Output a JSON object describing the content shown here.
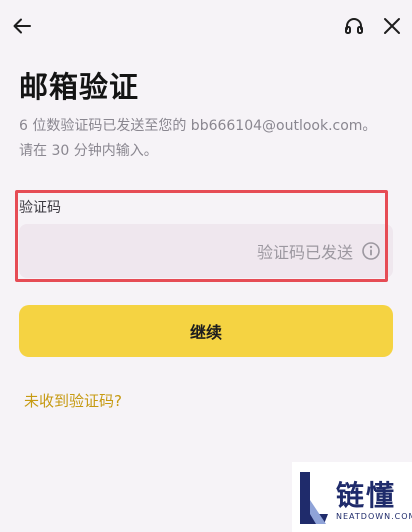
{
  "header": {
    "back_icon": "arrow-left-icon",
    "support_icon": "headset-icon",
    "close_icon": "close-icon"
  },
  "page": {
    "title": "邮箱验证",
    "description_line1": "6 位数验证码已发送至您的 bb666104@outlook.com。",
    "description_line2": "请在 30 分钟内输入。"
  },
  "code_field": {
    "label": "验证码",
    "status_text": "验证码已发送",
    "info_icon": "info-icon",
    "highlight_color": "#e64c55"
  },
  "actions": {
    "continue_label": "继续",
    "no_code_link": "未收到验证码?"
  },
  "watermark": {
    "brand": "链懂",
    "domain": "NEATDOWN.COM"
  },
  "colors": {
    "background": "#f6f3f7",
    "primary_button": "#f5d342",
    "link": "#c69a12",
    "input_bg": "#efe7ee"
  }
}
